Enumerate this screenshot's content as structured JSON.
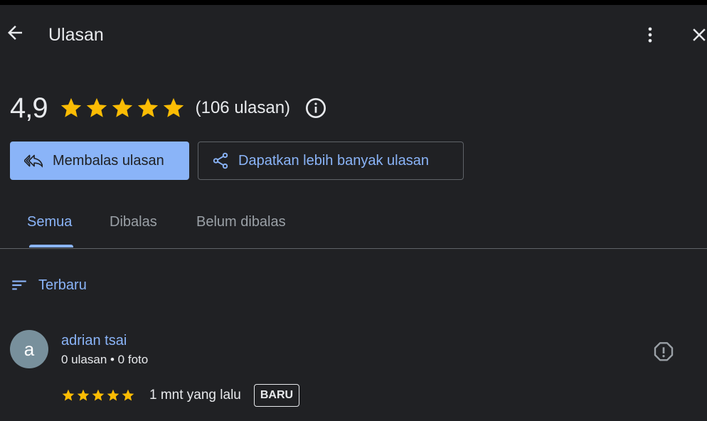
{
  "header": {
    "title": "Ulasan",
    "back_icon": "arrow-back-icon",
    "more_icon": "more-vert-icon",
    "close_icon": "close-icon"
  },
  "summary": {
    "rating": "4,9",
    "stars": 5,
    "review_count": "(106 ulasan)",
    "info_icon": "info-icon"
  },
  "actions": {
    "reply_label": "Membalas ulasan",
    "reply_icon": "reply-all-icon",
    "get_more_label": "Dapatkan lebih banyak ulasan",
    "get_more_icon": "share-icon"
  },
  "tabs": [
    {
      "label": "Semua",
      "active": true
    },
    {
      "label": "Dibalas",
      "active": false
    },
    {
      "label": "Belum dibalas",
      "active": false
    }
  ],
  "sort": {
    "label": "Terbaru",
    "icon": "sort-icon"
  },
  "reviews": [
    {
      "avatar_letter": "a",
      "name": "adrian tsai",
      "meta": "0 ulasan • 0 foto",
      "stars": 5,
      "time": "1 mnt yang lalu",
      "badge": "BARU",
      "report_icon": "report-icon"
    }
  ],
  "colors": {
    "background": "#202124",
    "accent": "#8ab4f8",
    "star": "#fbbc04",
    "text": "#e8eaed",
    "muted": "#9aa0a6",
    "avatar": "#78909c"
  }
}
